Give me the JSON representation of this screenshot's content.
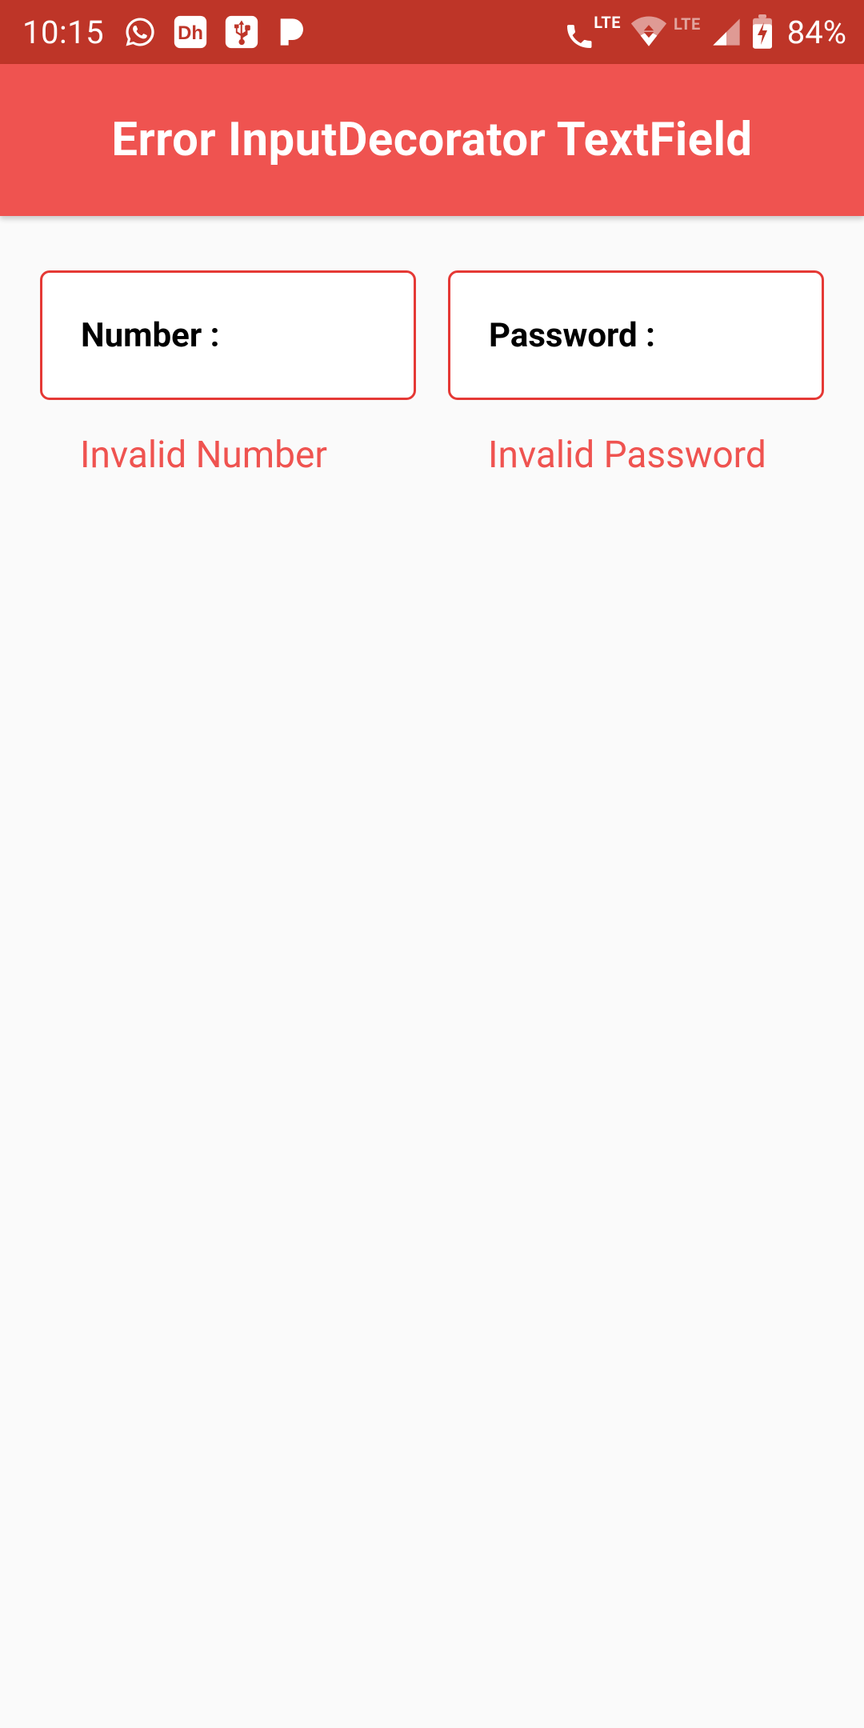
{
  "status_bar": {
    "time": "10:15",
    "lte_label": "LTE",
    "battery_pct": "84%",
    "icons": {
      "whatsapp": "whatsapp-icon",
      "dh": "dh-icon",
      "usb": "usb-icon",
      "pandora": "pandora-icon",
      "call_lte": "wifi-calling-icon",
      "wifi": "wifi-icon",
      "signal": "cellular-signal-icon",
      "battery": "battery-charging-icon"
    }
  },
  "app_bar": {
    "title": "Error InputDecorator TextField"
  },
  "form": {
    "number": {
      "label": "Number :",
      "value": "",
      "error": "Invalid Number"
    },
    "password": {
      "label": "Password :",
      "value": "",
      "error": "Invalid Password"
    }
  }
}
